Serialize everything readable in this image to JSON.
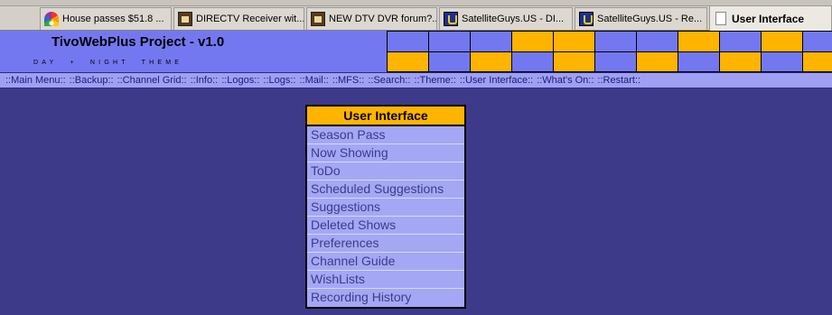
{
  "browser": {
    "tabs": [
      {
        "label": "House passes $51.8 ...",
        "icon": "nbc-peacock-icon"
      },
      {
        "label": "DIRECTV Receiver wit...",
        "icon": "tv-icon"
      },
      {
        "label": "NEW DTV DVR forum?...",
        "icon": "tv-icon"
      },
      {
        "label": "SatelliteGuys.US - DI...",
        "icon": "satelliteguys-icon"
      },
      {
        "label": "SatelliteGuys.US - Re...",
        "icon": "satelliteguys-icon"
      },
      {
        "label": "User Interface",
        "icon": "document-icon",
        "active": true
      }
    ]
  },
  "header": {
    "title": "TivoWebPlus Project - v1.0",
    "subtitle": "DAY + NIGHT THEME",
    "pattern": {
      "colors": {
        "blue": "#7478f0",
        "gold": "#ffb400"
      },
      "rows": [
        [
          "blue",
          "blue",
          "blue",
          "gold",
          "gold",
          "blue",
          "blue",
          "gold",
          "blue",
          "gold",
          "blue"
        ],
        [
          "gold",
          "blue",
          "gold",
          "blue",
          "gold",
          "blue",
          "gold",
          "blue",
          "gold",
          "blue",
          "gold"
        ]
      ]
    }
  },
  "nav": {
    "items": [
      "::Main Menu::",
      "::Backup::",
      "::Channel Grid::",
      "::Info::",
      "::Logos::",
      "::Logs::",
      "::Mail::",
      "::MFS::",
      "::Search::",
      "::Theme::",
      "::User Interface::",
      "::What's On::",
      "::Restart::"
    ]
  },
  "menu": {
    "title": "User Interface",
    "items": [
      "Season Pass",
      "Now Showing",
      "ToDo",
      "Scheduled Suggestions",
      "Suggestions",
      "Deleted Shows",
      "Preferences",
      "Channel Guide",
      "WishLists",
      "Recording History"
    ]
  },
  "colors": {
    "page_bg": "#3e3a8a",
    "header_bg": "#7478f0",
    "nav_bg": "#9ea0f2",
    "menu_bg": "#a4a8f4",
    "accent_gold": "#ffb400"
  }
}
